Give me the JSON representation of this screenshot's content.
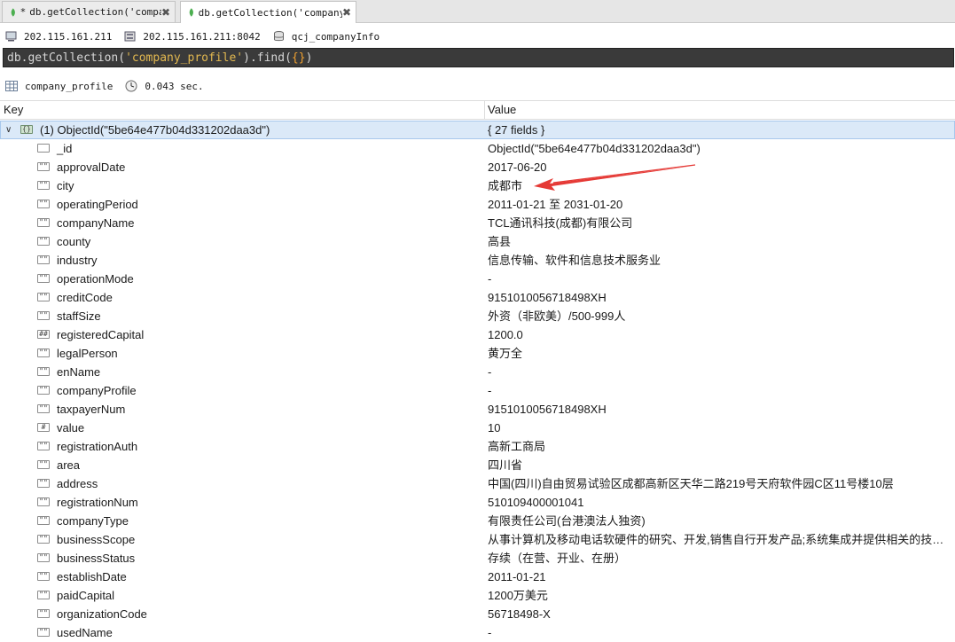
{
  "tabs": [
    {
      "modified": "*",
      "label": "db.getCollection('compa…",
      "close": "✖"
    },
    {
      "label": "db.getCollection('company…",
      "close": "✖"
    }
  ],
  "connection": {
    "host": "202.115.161.211",
    "host_port": "202.115.161.211:8042",
    "database": "qcj_companyInfo"
  },
  "query": {
    "prefix": "db.getCollection(",
    "collection_literal": "'company_profile'",
    "middle": ").find(",
    "braces": "{}",
    "suffix": ")"
  },
  "result_info": {
    "collection": "company_profile",
    "elapsed": "0.043 sec."
  },
  "columns": {
    "key": "Key",
    "value": "Value"
  },
  "document": {
    "key": "(1) ObjectId(\"5be64e477b04d331202daa3d\")",
    "value": "{ 27 fields }"
  },
  "fields": [
    {
      "icon": "",
      "key": "_id",
      "value": "ObjectId(\"5be64e477b04d331202daa3d\")"
    },
    {
      "icon": "\"\"",
      "key": "approvalDate",
      "value": "2017-06-20"
    },
    {
      "icon": "\"\"",
      "key": "city",
      "value": "成都市"
    },
    {
      "icon": "\"\"",
      "key": "operatingPeriod",
      "value": "2011-01-21 至 2031-01-20"
    },
    {
      "icon": "\"\"",
      "key": "companyName",
      "value": "TCL通讯科技(成都)有限公司"
    },
    {
      "icon": "\"\"",
      "key": "county",
      "value": "高县"
    },
    {
      "icon": "\"\"",
      "key": "industry",
      "value": "信息传输、软件和信息技术服务业"
    },
    {
      "icon": "\"\"",
      "key": "operationMode",
      "value": "-"
    },
    {
      "icon": "\"\"",
      "key": "creditCode",
      "value": "9151010056718498XH"
    },
    {
      "icon": "\"\"",
      "key": "staffSize",
      "value": "外资（非欧美）/500-999人"
    },
    {
      "icon": "##",
      "key": "registeredCapital",
      "value": "1200.0"
    },
    {
      "icon": "\"\"",
      "key": "legalPerson",
      "value": "黄万全"
    },
    {
      "icon": "\"\"",
      "key": "enName",
      "value": "-"
    },
    {
      "icon": "\"\"",
      "key": "companyProfile",
      "value": "-"
    },
    {
      "icon": "\"\"",
      "key": "taxpayerNum",
      "value": "9151010056718498XH"
    },
    {
      "icon": "#",
      "key": "value",
      "value": "10"
    },
    {
      "icon": "\"\"",
      "key": "registrationAuth",
      "value": "高新工商局"
    },
    {
      "icon": "\"\"",
      "key": "area",
      "value": "四川省"
    },
    {
      "icon": "\"\"",
      "key": "address",
      "value": "中国(四川)自由贸易试验区成都高新区天华二路219号天府软件园C区11号楼10层"
    },
    {
      "icon": "\"\"",
      "key": "registrationNum",
      "value": "510109400001041"
    },
    {
      "icon": "\"\"",
      "key": "companyType",
      "value": "有限责任公司(台港澳法人独资)"
    },
    {
      "icon": "\"\"",
      "key": "businessScope",
      "value": "从事计算机及移动电话软硬件的研究、开发,销售自行开发产品;系统集成并提供相关的技术与咨询服…"
    },
    {
      "icon": "\"\"",
      "key": "businessStatus",
      "value": "存续（在营、开业、在册）"
    },
    {
      "icon": "\"\"",
      "key": "establishDate",
      "value": "2011-01-21"
    },
    {
      "icon": "\"\"",
      "key": "paidCapital",
      "value": "1200万美元"
    },
    {
      "icon": "\"\"",
      "key": "organizationCode",
      "value": "56718498-X"
    },
    {
      "icon": "\"\"",
      "key": "usedName",
      "value": "-"
    }
  ],
  "colors": {
    "selected_row": "#dbe9f8",
    "query_bg": "#3a3a3a",
    "string_literal": "#e2b850",
    "arrow": "#e53935",
    "mongo_leaf": "#4caf50"
  }
}
